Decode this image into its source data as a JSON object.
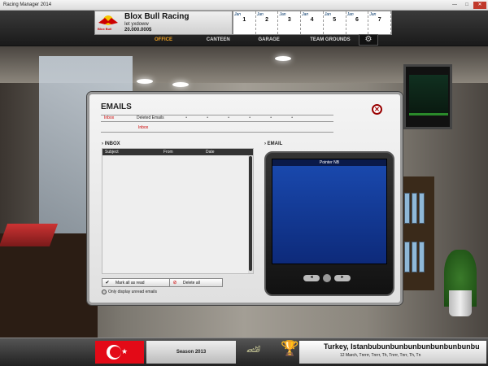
{
  "window": {
    "title": "Racing Manager 2014",
    "min": "—",
    "max": "□",
    "close": "✕"
  },
  "header": {
    "team_name": "Blox Bull Racing",
    "logo_text": "Blox Bull",
    "manager": "Iet yxdoww",
    "money": "20.000.000$",
    "calendar": [
      {
        "label": "Jan",
        "num": "1"
      },
      {
        "label": "Jan",
        "num": "2"
      },
      {
        "label": "Jan",
        "num": "3"
      },
      {
        "label": "Jan",
        "num": "4"
      },
      {
        "label": "Jan",
        "num": "5"
      },
      {
        "label": "Jan",
        "num": "6"
      },
      {
        "label": "Jan",
        "num": "7"
      }
    ],
    "menu": [
      "OFFICE",
      "CANTEEN",
      "GARAGE",
      "TEAM GROUNDS"
    ],
    "settings_icon": "gear-icon"
  },
  "dialog": {
    "title": "EMAILS",
    "tabs": [
      "Inbox",
      "Deleted Emails"
    ],
    "subtab": "Inbox",
    "inbox_header": "INBOX",
    "columns": [
      "Subject",
      "From",
      "Date"
    ],
    "mark_read": "Mark all as read",
    "delete_all": "Delete all",
    "unread_only": "Only display unread emails",
    "email_header": "EMAIL",
    "device_title": "Pointer NB"
  },
  "footer": {
    "season": "Season 2013",
    "race_name": "Turkey, Istanbubunbunbunbunbunbunbunbu",
    "race_schedule": "12 March, Tnrrrr, Tnrrr, Th, Tnrrr, Tnrr, Th, Tn"
  },
  "colors": {
    "accent": "#f0a020",
    "tab_active": "#cc0000",
    "screen": "#1a4ab0"
  }
}
